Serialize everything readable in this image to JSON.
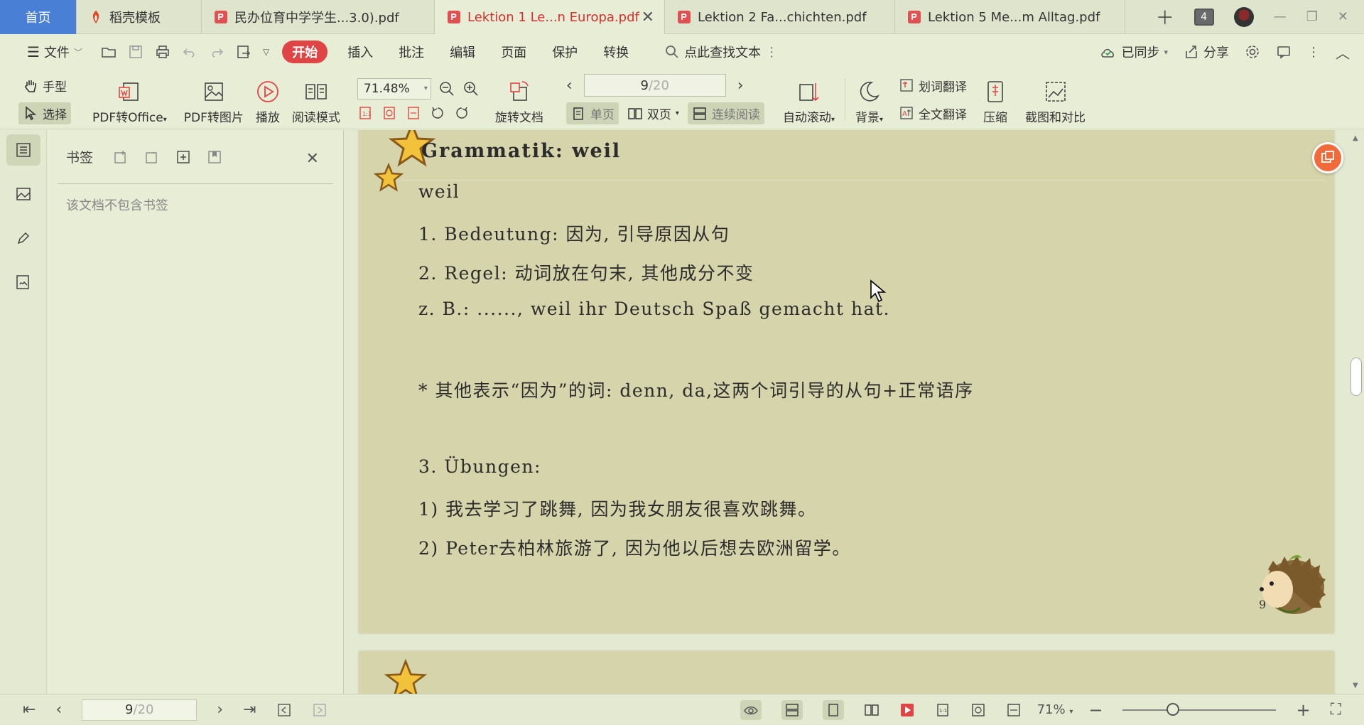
{
  "tabs": [
    {
      "label": "首页",
      "kind": "home"
    },
    {
      "label": "稻壳模板",
      "kind": "docer"
    },
    {
      "label": "民办位育中学学生...3.0).pdf",
      "kind": "pdf"
    },
    {
      "label": "Lektion 1 Le...n Europa.pdf",
      "kind": "pdf",
      "active": true
    },
    {
      "label": "Lektion 2 Fa...chichten.pdf",
      "kind": "pdf"
    },
    {
      "label": "Lektion 5 Me...m Alltag.pdf",
      "kind": "pdf"
    }
  ],
  "tabbar": {
    "window_count": "4"
  },
  "menu": {
    "file_label": "文件",
    "items": [
      "开始",
      "插入",
      "批注",
      "编辑",
      "页面",
      "保护",
      "转换"
    ],
    "search_label": "点此查找文本",
    "sync_label": "已同步",
    "share_label": "分享"
  },
  "ribbon": {
    "hand_label": "手型",
    "select_label": "选择",
    "pdf_to_office": "PDF转Office",
    "pdf_to_image": "PDF转图片",
    "play": "播放",
    "read_mode": "阅读模式",
    "zoom_value": "71.48%",
    "rotate_doc": "旋转文档",
    "page_current": "9",
    "page_total": "/20",
    "single_page": "单页",
    "double_page": "双页",
    "continuous": "连续阅读",
    "auto_scroll": "自动滚动",
    "background": "背景",
    "word_translate": "划词翻译",
    "full_translate": "全文翻译",
    "compress": "压缩",
    "screenshot_compare": "截图和对比"
  },
  "bookmarks": {
    "title": "书签",
    "empty_text": "该文档不包含书签"
  },
  "document": {
    "heading": "Grammatik: weil",
    "lines": [
      "weil",
      "1. Bedeutung: 因为, 引导原因从句",
      "2. Regel: 动词放在句末, 其他成分不变",
      "z. B.: ......, weil ihr Deutsch Spaß gemacht hat.",
      "*  其他表示“因为”的词: denn, da,这两个词引导的从句+正常语序",
      "3. Übungen:",
      "1)  我去学习了跳舞, 因为我女朋友很喜欢跳舞。",
      "2)  Peter去柏林旅游了, 因为他以后想去欧洲留学。"
    ],
    "page_number": "9"
  },
  "statusbar": {
    "page_current": "9",
    "page_total": "/20",
    "zoom": "71%"
  },
  "colors": {
    "accent_red": "#e04545",
    "home_tab_blue": "#4a7fd6",
    "page_bg": "#d6d4aa",
    "ui_bg": "#e8edd6"
  }
}
